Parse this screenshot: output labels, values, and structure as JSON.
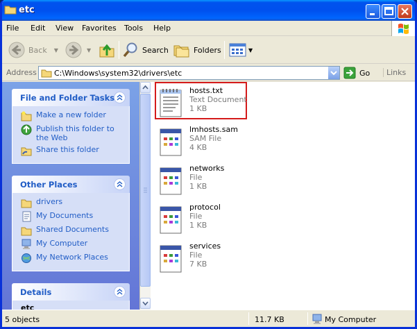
{
  "window": {
    "title": "etc"
  },
  "menu": [
    "File",
    "Edit",
    "View",
    "Favorites",
    "Tools",
    "Help"
  ],
  "toolbar": {
    "back": "Back",
    "search": "Search",
    "folders": "Folders"
  },
  "address": {
    "label": "Address",
    "path": "C:\\Windows\\system32\\drivers\\etc",
    "go": "Go",
    "links": "Links"
  },
  "tasks": {
    "file_folder": {
      "title": "File and Folder Tasks",
      "items": [
        "Make a new folder",
        "Publish this folder to the Web",
        "Share this folder"
      ]
    },
    "other_places": {
      "title": "Other Places",
      "items": [
        "drivers",
        "My Documents",
        "Shared Documents",
        "My Computer",
        "My Network Places"
      ]
    },
    "details": {
      "title": "Details",
      "name": "etc"
    }
  },
  "files": [
    {
      "name": "hosts.txt",
      "type": "Text Document",
      "size": "1 KB",
      "icon": "notepad-icon",
      "selected": true
    },
    {
      "name": "lmhosts.sam",
      "type": "SAM File",
      "size": "4 KB",
      "icon": "generic-file-icon"
    },
    {
      "name": "networks",
      "type": "File",
      "size": "1 KB",
      "icon": "generic-file-icon"
    },
    {
      "name": "protocol",
      "type": "File",
      "size": "1 KB",
      "icon": "generic-file-icon"
    },
    {
      "name": "services",
      "type": "File",
      "size": "7 KB",
      "icon": "generic-file-icon"
    }
  ],
  "status": {
    "objects": "5 objects",
    "size": "11.7 KB",
    "location": "My Computer"
  },
  "colors": {
    "title_blue": "#0053ee",
    "highlight_red": "#d41a1a",
    "task_link": "#215dc6"
  }
}
